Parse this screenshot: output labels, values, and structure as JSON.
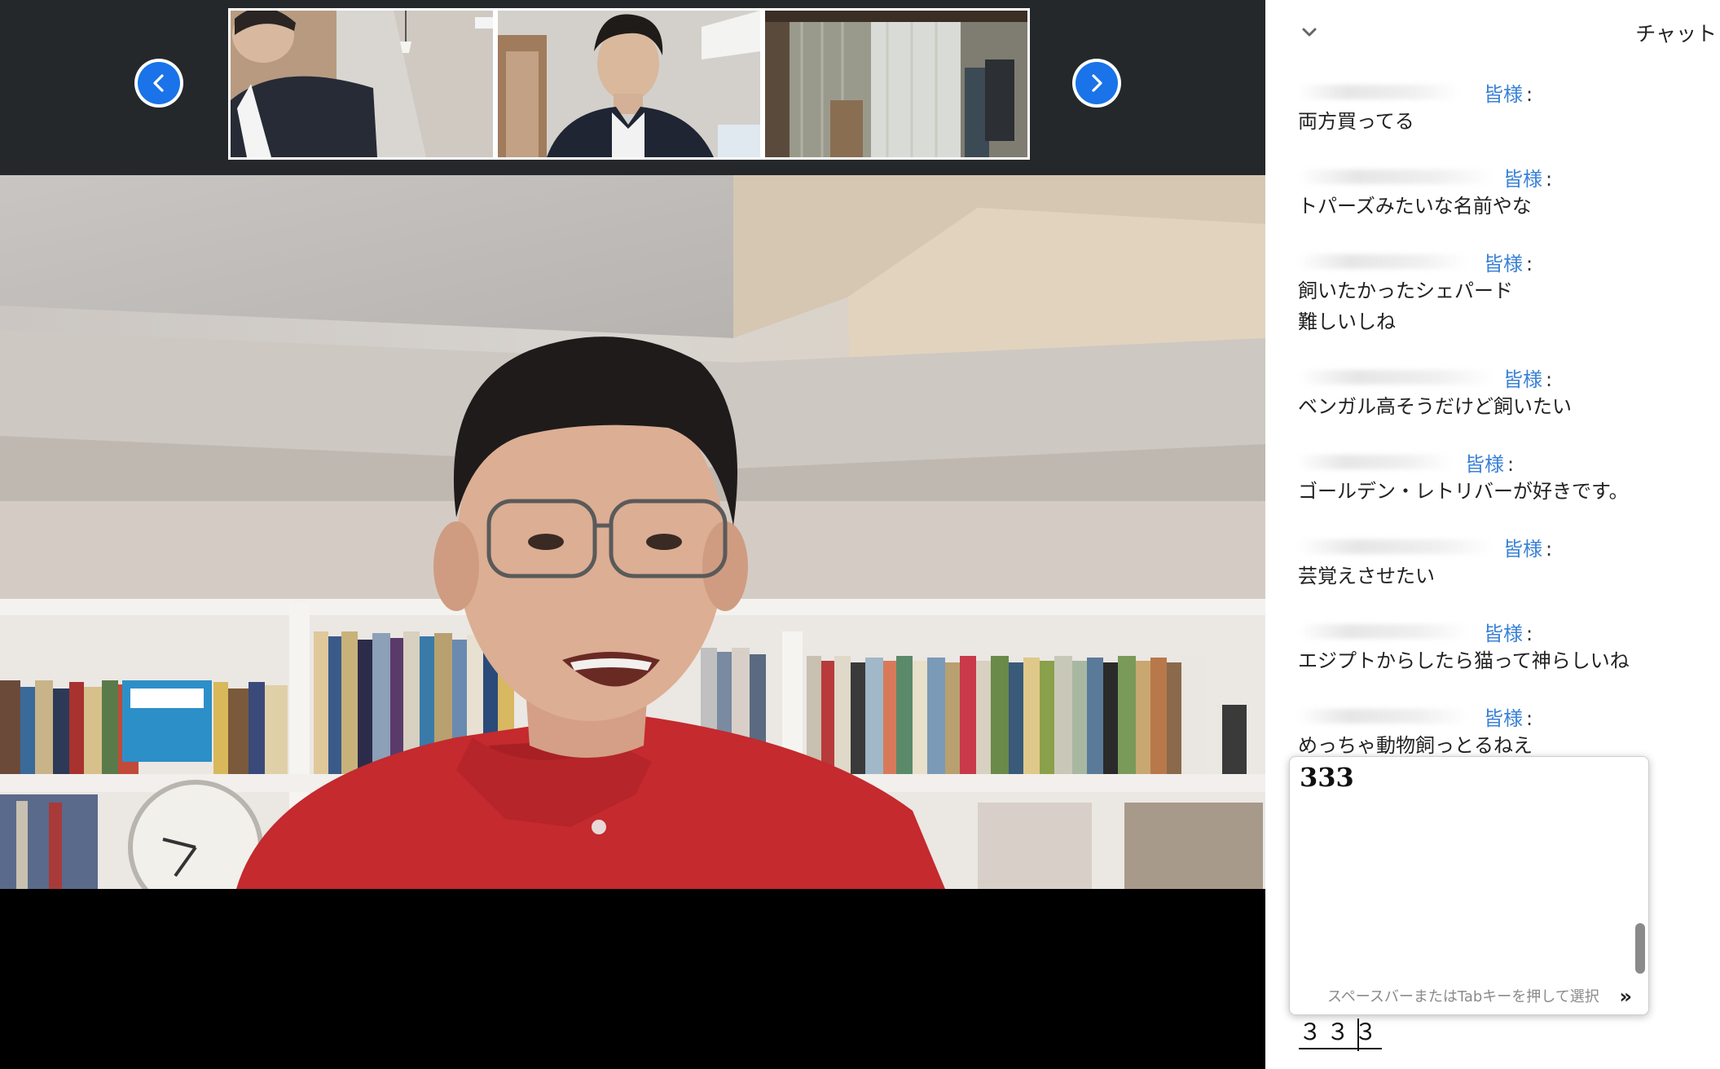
{
  "chat": {
    "title": "チャット",
    "messages": [
      {
        "recipient": "皆様",
        "colon": ":",
        "lines": [
          "両方買ってる"
        ]
      },
      {
        "recipient": "皆様",
        "colon": ":",
        "lines": [
          "トパーズみたいな名前やな"
        ]
      },
      {
        "recipient": "皆様",
        "colon": ":",
        "lines": [
          "飼いたかったシェパード",
          "難しいしね"
        ]
      },
      {
        "recipient": "皆様",
        "colon": ":",
        "lines": [
          "ベンガル高そうだけど飼いたい"
        ]
      },
      {
        "recipient": "皆様",
        "colon": ":",
        "lines": [
          "ゴールデン・レトリバーが好きです。"
        ]
      },
      {
        "recipient": "皆様",
        "colon": ":",
        "lines": [
          "芸覚えさせたい"
        ]
      },
      {
        "recipient": "皆様",
        "colon": ":",
        "lines": [
          "エジプトからしたら猫って神らしいね"
        ]
      },
      {
        "recipient": "皆様",
        "colon": ":",
        "lines": [
          "めっちゃ動物飼っとるねえ"
        ]
      }
    ],
    "ime": {
      "candidate": "333",
      "hint": "スペースバーまたはTabキーを押して選択",
      "hint_arrow": "»"
    },
    "input_value": "３３３"
  },
  "colors": {
    "accent": "#1a73e8",
    "recipient": "#3b82d6",
    "strip_bg": "#25282b"
  },
  "icons": {
    "prev": "chevron-left-icon",
    "next": "chevron-right-icon",
    "collapse": "chevron-down-icon"
  }
}
